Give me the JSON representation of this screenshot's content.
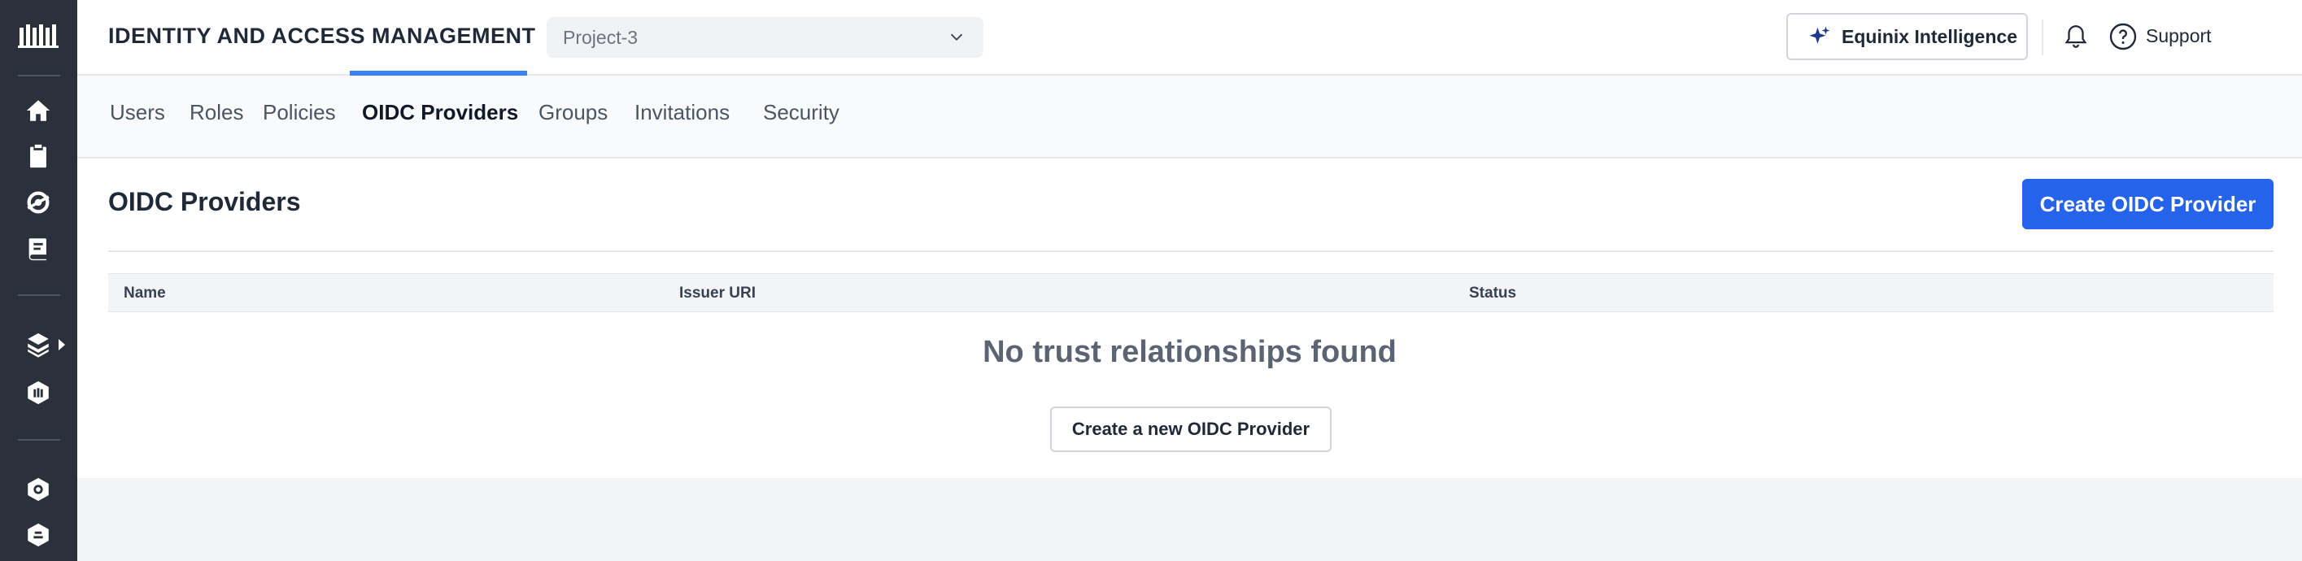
{
  "app": {
    "title": "IDENTITY AND ACCESS MANAGEMENT",
    "project": "Project-3"
  },
  "header": {
    "intelligence_label": "Equinix Intelligence",
    "support_label": "Support"
  },
  "tabs": [
    {
      "label": "Users",
      "active": false
    },
    {
      "label": "Roles",
      "active": false
    },
    {
      "label": "Policies",
      "active": false
    },
    {
      "label": "OIDC Providers",
      "active": true
    },
    {
      "label": "Groups",
      "active": false
    },
    {
      "label": "Invitations",
      "active": false
    },
    {
      "label": "Security",
      "active": false
    }
  ],
  "main": {
    "title": "OIDC Providers",
    "create_button": "Create OIDC Provider",
    "columns": [
      "Name",
      "Issuer URI",
      "Status"
    ],
    "empty_title": "No trust relationships found",
    "empty_button": "Create a new OIDC Provider"
  },
  "sidebar": {
    "icons": [
      "equinix-logo-icon",
      "home-icon",
      "clipboard-icon",
      "globe-icon",
      "book-icon",
      "layers-icon",
      "equinix-box-icon",
      "settings-cube-icon",
      "network-cube-icon"
    ]
  },
  "colors": {
    "sidebar_bg": "#2b313b",
    "primary": "#2563eb",
    "tab_indicator": "#3b82f6",
    "star_accent": "#1e3a8a"
  }
}
